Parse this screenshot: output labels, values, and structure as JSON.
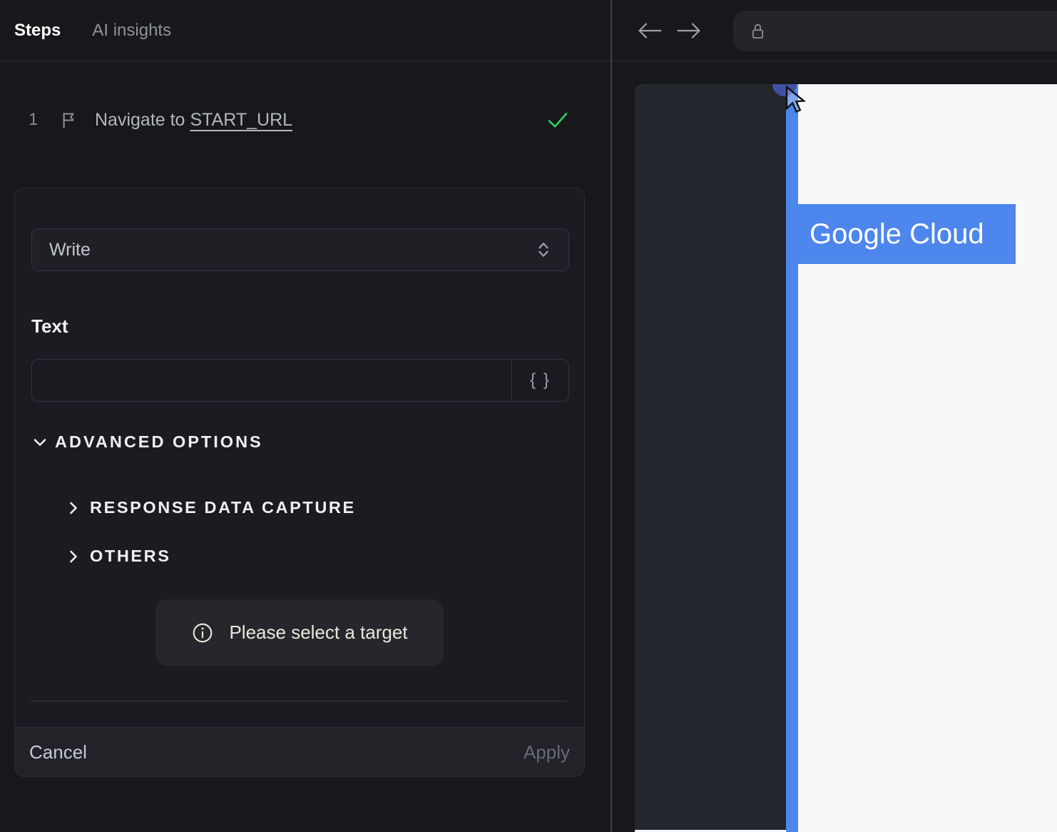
{
  "left_panel": {
    "tabs": {
      "steps_label": "Steps",
      "ai_insights_label": "AI insights"
    },
    "step": {
      "number": "1",
      "action_text": "Navigate to",
      "target_text": "START_URL",
      "status": "success"
    },
    "editor": {
      "action_select_value": "Write",
      "text_field": {
        "label": "Text",
        "value": "",
        "placeholder": ""
      },
      "variable_button_label": "{ }",
      "sections": {
        "advanced_options": "ADVANCED OPTIONS",
        "response_data_capture": "RESPONSE DATA CAPTURE",
        "others": "OTHERS"
      },
      "target_hint_text": "Please select a target",
      "footer": {
        "cancel_label": "Cancel",
        "apply_label": "Apply"
      }
    }
  },
  "browser": {
    "toolbar": {
      "url_value": "",
      "url_placeholder": ""
    },
    "page": {
      "brand_label": "Google Cloud"
    }
  },
  "icons": {
    "flag-icon": "outlined pennant flag",
    "check-icon": "green checkmark",
    "select-updown-icon": "stacked up and down chevrons",
    "chevron-down-icon": "chevron pointing down",
    "chevron-right-icon": "chevron pointing right",
    "braces-icon": "curly braces variable insert",
    "info-icon": "letter i in circle",
    "back-arrow-icon": "left arrow",
    "forward-arrow-icon": "right arrow",
    "lock-icon": "padlock outline",
    "cursor-icon": "mouse pointer arrow"
  },
  "colors": {
    "accent_blue": "#4d86ec",
    "success_green": "#2fd160",
    "hint_text_cream": "#ece7da",
    "panel_bg": "#17181c",
    "preview_sidebar_bg": "#24262e"
  }
}
